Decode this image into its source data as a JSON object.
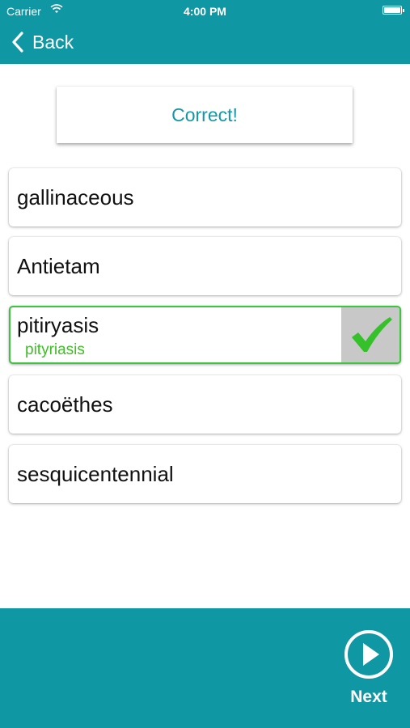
{
  "status_bar": {
    "carrier": "Carrier",
    "time": "4:00 PM"
  },
  "nav": {
    "back_label": "Back"
  },
  "feedback": {
    "text": "Correct!"
  },
  "options": [
    {
      "word": "gallinaceous"
    },
    {
      "word": "Antietam"
    },
    {
      "word": "pitiryasis",
      "correction": "pityriasis",
      "state": "correct"
    },
    {
      "word": "cacoëthes"
    },
    {
      "word": "sesquicentennial"
    }
  ],
  "footer": {
    "next_label": "Next"
  },
  "colors": {
    "teal": "#0f97a3",
    "correct_green": "#3cbf22",
    "check_bg": "#c8c8c8"
  },
  "icons": {
    "back": "chevron-left-icon",
    "next": "play-circle-icon",
    "check": "checkmark-icon"
  }
}
